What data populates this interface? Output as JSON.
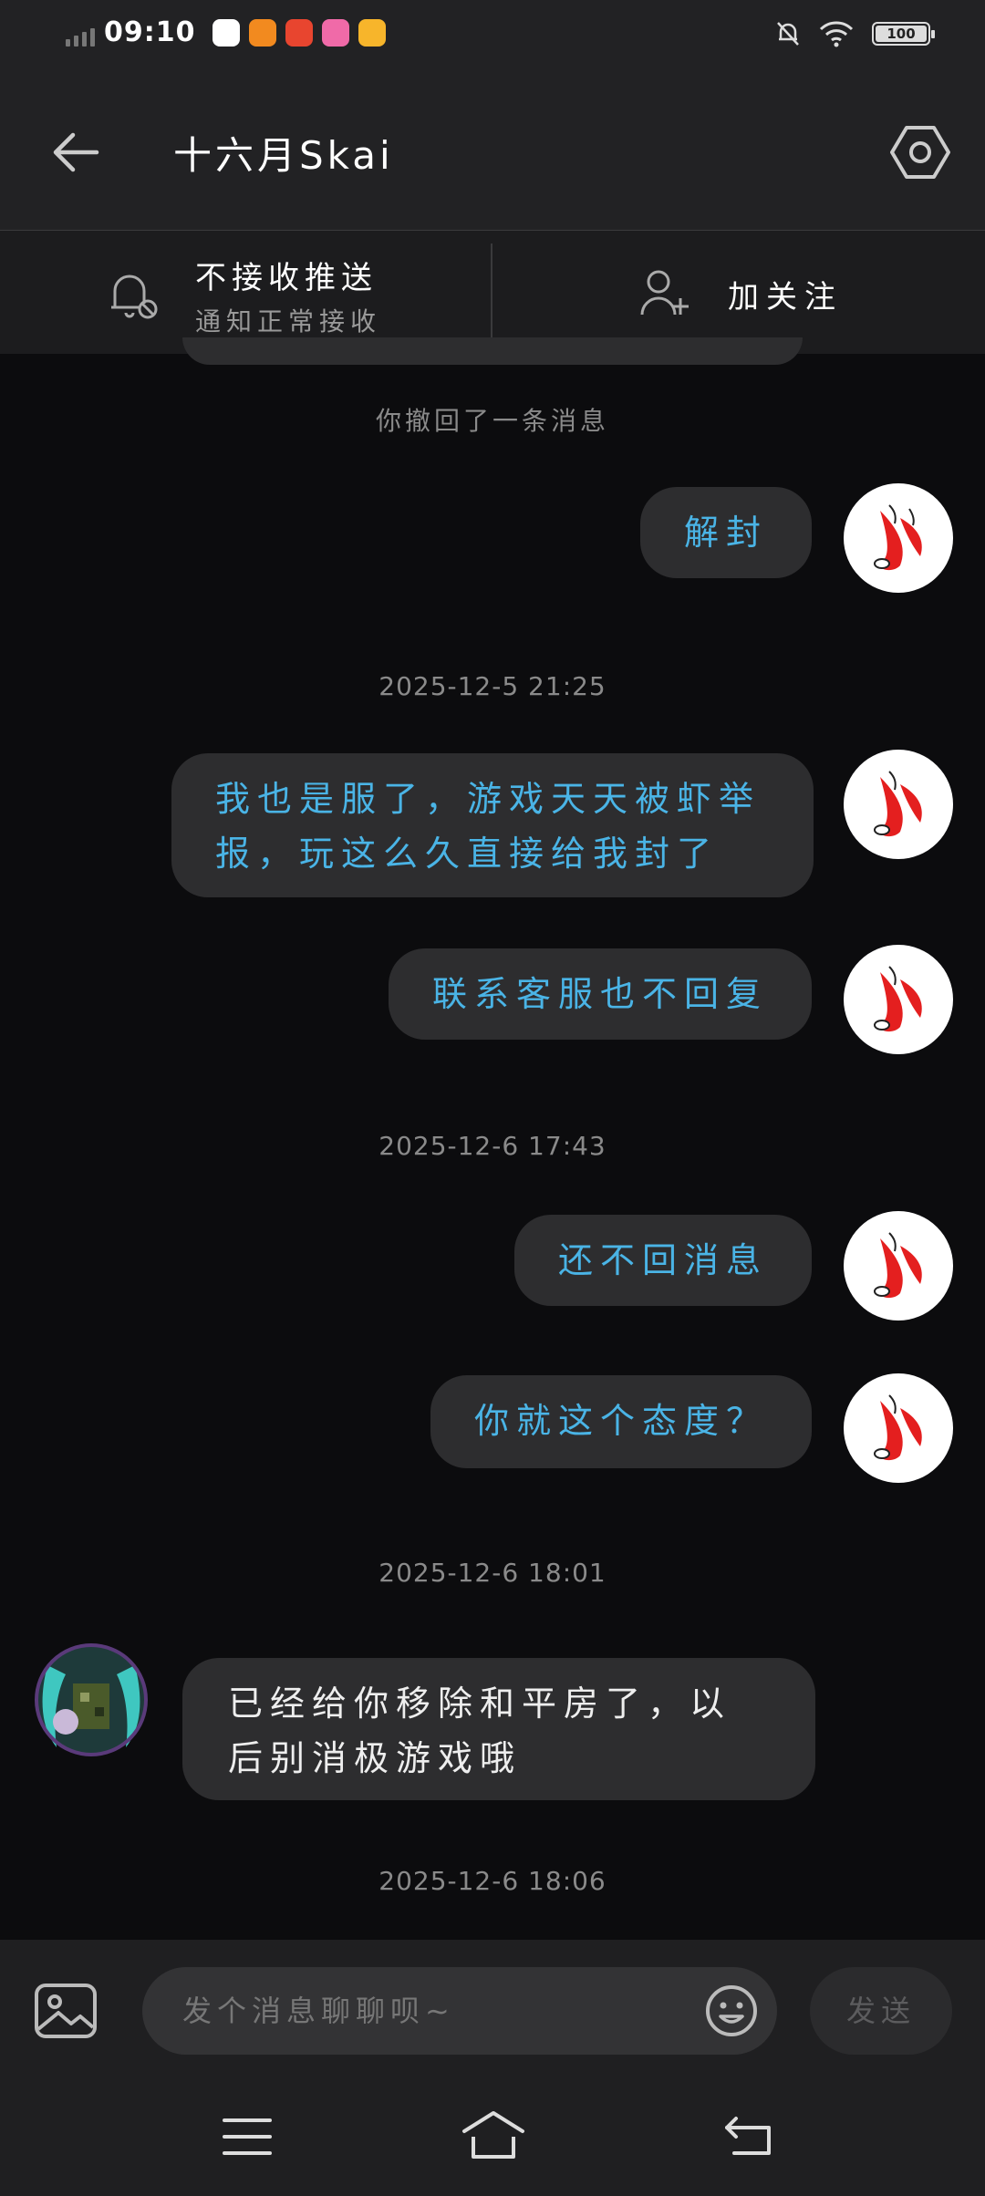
{
  "status_bar": {
    "time": "09:10",
    "battery": "100"
  },
  "header": {
    "title": "十六月Skai"
  },
  "notify_bar": {
    "title": "不接收推送",
    "subtitle": "通知正常接收",
    "follow_label": "加关注"
  },
  "messages": [
    {
      "kind": "system",
      "text": "你撤回了一条消息"
    },
    {
      "kind": "out",
      "text": "解封"
    },
    {
      "kind": "time",
      "text": "2025-12-5 21:25"
    },
    {
      "kind": "out",
      "text": "我也是服了，游戏天天被虾举报，玩这么久直接给我封了"
    },
    {
      "kind": "out",
      "text": "联系客服也不回复"
    },
    {
      "kind": "time",
      "text": "2025-12-6 17:43"
    },
    {
      "kind": "out",
      "text": "还不回消息"
    },
    {
      "kind": "out",
      "text": "你就这个态度？"
    },
    {
      "kind": "time",
      "text": "2025-12-6 18:01"
    },
    {
      "kind": "in",
      "text": "已经给你移除和平房了，以后别消极游戏哦"
    },
    {
      "kind": "time",
      "text": "2025-12-6 18:06"
    }
  ],
  "input": {
    "placeholder": "发个消息聊聊呗~",
    "send_label": "发送"
  },
  "icons": {
    "back": "arrow-left-icon",
    "settings": "hexagon-settings-icon",
    "bell": "bell-muted-icon",
    "follow": "add-user-icon",
    "image": "image-icon",
    "emoji": "emoji-icon",
    "nav_menu": "menu-icon",
    "nav_home": "home-icon",
    "nav_back": "return-icon"
  },
  "colors": {
    "outgoing_text": "#4ab4e6",
    "bubble_bg": "#2d2d2f",
    "background": "#0c0c0e"
  }
}
